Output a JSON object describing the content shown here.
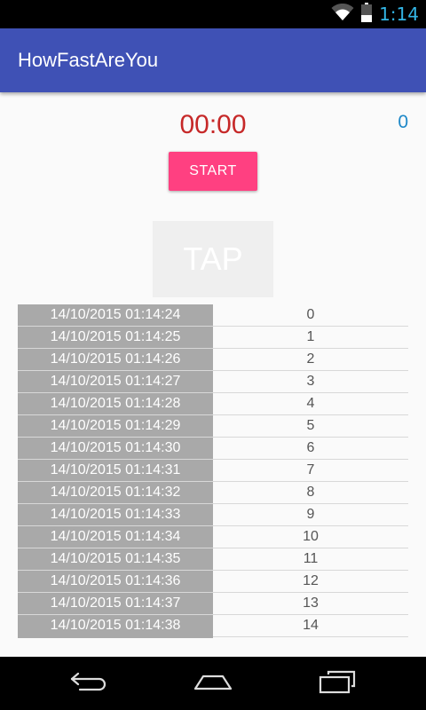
{
  "status_bar": {
    "time": "1:14",
    "wifi_icon": "wifi-icon",
    "battery_icon": "battery-icon"
  },
  "app_bar": {
    "title": "HowFastAreYou"
  },
  "timer": {
    "value": "00:00",
    "color": "#c62828"
  },
  "counter": {
    "value": "0"
  },
  "start_button": {
    "label": "START",
    "color": "#ff4081"
  },
  "tap_button": {
    "label": "TAP"
  },
  "list": {
    "rows": [
      {
        "time": "14/10/2015 01:14:24",
        "index": "0"
      },
      {
        "time": "14/10/2015 01:14:25",
        "index": "1"
      },
      {
        "time": "14/10/2015 01:14:26",
        "index": "2"
      },
      {
        "time": "14/10/2015 01:14:27",
        "index": "3"
      },
      {
        "time": "14/10/2015 01:14:28",
        "index": "4"
      },
      {
        "time": "14/10/2015 01:14:29",
        "index": "5"
      },
      {
        "time": "14/10/2015 01:14:30",
        "index": "6"
      },
      {
        "time": "14/10/2015 01:14:31",
        "index": "7"
      },
      {
        "time": "14/10/2015 01:14:32",
        "index": "8"
      },
      {
        "time": "14/10/2015 01:14:33",
        "index": "9"
      },
      {
        "time": "14/10/2015 01:14:34",
        "index": "10"
      },
      {
        "time": "14/10/2015 01:14:35",
        "index": "11"
      },
      {
        "time": "14/10/2015 01:14:36",
        "index": "12"
      },
      {
        "time": "14/10/2015 01:14:37",
        "index": "13"
      },
      {
        "time": "14/10/2015 01:14:38",
        "index": "14"
      }
    ]
  },
  "nav_bar": {
    "back_icon": "back-icon",
    "home_icon": "home-icon",
    "recents_icon": "recents-icon"
  },
  "colors": {
    "app_bar": "#3f51b5",
    "accent": "#ff4081",
    "counter": "#1e88c8",
    "row_background": "#a9a9a9"
  }
}
